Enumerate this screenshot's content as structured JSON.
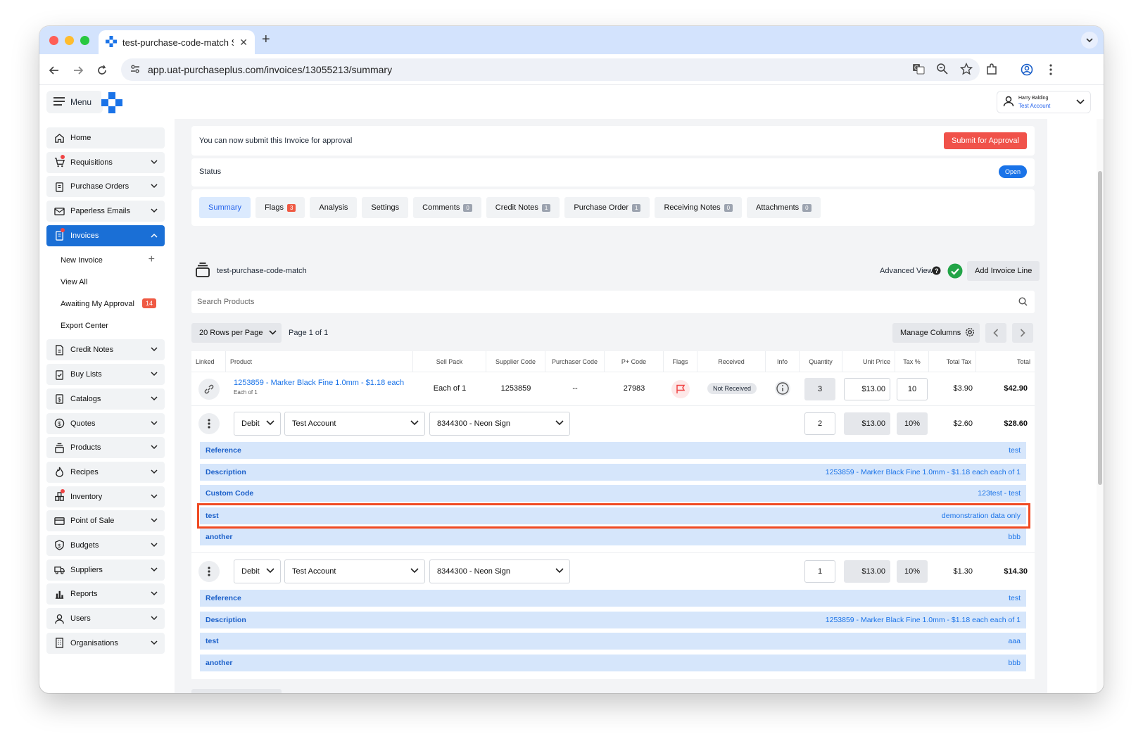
{
  "browser": {
    "tab_title": "test-purchase-code-match S",
    "url": "app.uat-purchaseplus.com/invoices/13055213/summary"
  },
  "header": {
    "menu_label": "Menu",
    "user_name": "Harry Balding",
    "user_account": "Test Account"
  },
  "sidebar": {
    "items": [
      {
        "label": "Home"
      },
      {
        "label": "Requisitions"
      },
      {
        "label": "Purchase Orders"
      },
      {
        "label": "Paperless Emails"
      },
      {
        "label": "Invoices"
      },
      {
        "label": "Credit Notes"
      },
      {
        "label": "Buy Lists"
      },
      {
        "label": "Catalogs"
      },
      {
        "label": "Quotes"
      },
      {
        "label": "Products"
      },
      {
        "label": "Recipes"
      },
      {
        "label": "Inventory"
      },
      {
        "label": "Point of Sale"
      },
      {
        "label": "Budgets"
      },
      {
        "label": "Suppliers"
      },
      {
        "label": "Reports"
      },
      {
        "label": "Users"
      },
      {
        "label": "Organisations"
      }
    ],
    "invoice_sub": [
      {
        "label": "New Invoice"
      },
      {
        "label": "View All"
      },
      {
        "label": "Awaiting My Approval",
        "badge": "14"
      },
      {
        "label": "Export Center"
      }
    ]
  },
  "banner": {
    "message": "You can now submit this Invoice for approval",
    "submit_label": "Submit for Approval"
  },
  "status": {
    "label": "Status",
    "value": "Open"
  },
  "tabs": [
    {
      "label": "Summary"
    },
    {
      "label": "Flags",
      "badge": "3"
    },
    {
      "label": "Analysis"
    },
    {
      "label": "Settings"
    },
    {
      "label": "Comments",
      "badge": "0"
    },
    {
      "label": "Credit Notes",
      "badge": "1"
    },
    {
      "label": "Purchase Order",
      "badge": "1"
    },
    {
      "label": "Receiving Notes",
      "badge": "0"
    },
    {
      "label": "Attachments",
      "badge": "0"
    }
  ],
  "invoice": {
    "title": "test-purchase-code-match",
    "advanced_view_label": "Advanced View",
    "add_line_label": "Add Invoice Line",
    "search_placeholder": "Search Products",
    "rows_per_page": "20 Rows per Page",
    "page_info": "Page 1 of 1",
    "manage_columns": "Manage Columns"
  },
  "table": {
    "headers": [
      "Linked",
      "Product",
      "Sell Pack",
      "Supplier Code",
      "Purchaser Code",
      "P+ Code",
      "Flags",
      "Received",
      "Info",
      "Quantity",
      "Unit Price",
      "Tax %",
      "Total Tax",
      "Total"
    ],
    "line": {
      "product": "1253859 - Marker Black Fine 1.0mm - $1.18 each",
      "product_sub": "Each of 1",
      "sell_pack": "Each of 1",
      "supplier_code": "1253859",
      "purchaser_code": "--",
      "p_code": "27983",
      "received": "Not Received",
      "quantity": "3",
      "unit_price": "$13.00",
      "tax": "10",
      "total_tax": "$3.90",
      "total": "$42.90"
    },
    "splits": [
      {
        "type": "Debit",
        "account": "Test Account",
        "code": "8344300 - Neon Sign",
        "quantity": "2",
        "unit_price": "$13.00",
        "tax": "10%",
        "total_tax": "$2.60",
        "total": "$28.60",
        "fields": [
          {
            "key": "Reference",
            "value": "test"
          },
          {
            "key": "Description",
            "value": "1253859 - Marker Black Fine 1.0mm - $1.18 each each of 1"
          },
          {
            "key": "Custom Code",
            "value": "123test - test"
          },
          {
            "key": "test",
            "value": "demonstration data only"
          },
          {
            "key": "another",
            "value": "bbb"
          }
        ]
      },
      {
        "type": "Debit",
        "account": "Test Account",
        "code": "8344300 - Neon Sign",
        "quantity": "1",
        "unit_price": "$13.00",
        "tax": "10%",
        "total_tax": "$1.30",
        "total": "$14.30",
        "fields": [
          {
            "key": "Reference",
            "value": "test"
          },
          {
            "key": "Description",
            "value": "1253859 - Marker Black Fine 1.0mm - $1.18 each each of 1"
          },
          {
            "key": "test",
            "value": "aaa"
          },
          {
            "key": "another",
            "value": "bbb"
          }
        ]
      }
    ]
  },
  "colors": {
    "primary": "#1a6fd6",
    "danger": "#f0524a",
    "band": "#d6e6fb",
    "highlight": "#f04a23",
    "success": "#22a447"
  }
}
